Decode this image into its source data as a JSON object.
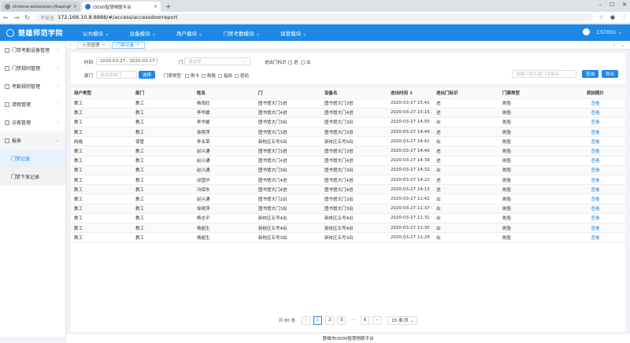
{
  "browser": {
    "tabs": [
      {
        "title": "chrome-extension://kapngfni",
        "active": false
      },
      {
        "title": "I3000智慧物联平台",
        "active": true
      }
    ],
    "new_tab": "+",
    "insecure_label": "不安全",
    "url": "172.168.10.8:8888/#/access/accessdoorreport"
  },
  "app": {
    "title": "楚雄师范学院",
    "nav": [
      "公共模块 ⌄",
      "设备模块 ⌄",
      "用户模块 ⌄",
      "门禁考勤模块 ⌄",
      "保管模块 ⌄"
    ],
    "user": "CST001 ⌄"
  },
  "sidebar": {
    "items": [
      {
        "label": "门禁考勤设备管理"
      },
      {
        "label": "门禁规则管理"
      },
      {
        "label": "考勤规则管理"
      },
      {
        "label": "请假管理"
      },
      {
        "label": "访客管理"
      },
      {
        "label": "报表"
      }
    ],
    "subitems": [
      {
        "label": "门禁记录",
        "active": true
      },
      {
        "label": "门禁下发记录",
        "active": false
      }
    ]
  },
  "page_tabs": [
    {
      "label": "人员管理",
      "active": false
    },
    {
      "label": "门禁记录",
      "active": true
    }
  ],
  "filter": {
    "time_label": "时间",
    "time_value": "2020-03-27 - 2020-03-27",
    "door_label": "门",
    "door_placeholder": "请选择",
    "inout_label": "进出门标识",
    "opt_in": "进",
    "opt_out": "出",
    "dept_label": "部门",
    "dept_placeholder": "请选择部门",
    "select_btn": "选择",
    "type_label": "门禁类型",
    "types": [
      "刷卡",
      "刷脸",
      "指纹",
      "密码"
    ],
    "search_placeholder": "请输入姓名或门设备名",
    "search_btn": "查询",
    "export_btn": "导出"
  },
  "table": {
    "columns": [
      "用户类型",
      "部门",
      "姓名",
      "门",
      "设备名",
      "进出时间 ⇕",
      "进出门标识",
      "门禁类型",
      "抓拍照片"
    ],
    "rows": [
      [
        "教工",
        "教工",
        "杨雨旺",
        "图书馆大门3进",
        "图书馆大门3进",
        "2020-03-27 15:41",
        "进",
        "刷脸",
        "查看"
      ],
      [
        "教工",
        "教工",
        "李华媛",
        "图书馆大门4进",
        "图书馆大门4进",
        "2020-03-27 15:15",
        "进",
        "刷脸",
        "查看"
      ],
      [
        "教工",
        "教工",
        "李华媛",
        "图书馆大门3出",
        "图书馆大门3出",
        "2020-03-27 14:55",
        "出",
        "刷脸",
        "查看"
      ],
      [
        "教工",
        "教工",
        "徐艳萍",
        "图书馆大门3进",
        "图书馆大门3进",
        "2020-03-27 14:44",
        "进",
        "刷脸",
        "查看"
      ],
      [
        "网格",
        "保管",
        "李永荣",
        "新校区五号5出",
        "新校区五号5出",
        "2020-03-27 14:41",
        "出",
        "刷脸",
        "查看"
      ],
      [
        "教工",
        "教工",
        "赵兴通",
        "图书馆大门3进",
        "图书馆大门3进",
        "2020-03-27 14:40",
        "进",
        "刷脸",
        "查看"
      ],
      [
        "教工",
        "教工",
        "赵兴通",
        "图书馆大门4进",
        "图书馆大门4进",
        "2020-03-27 14:39",
        "进",
        "刷脸",
        "查看"
      ],
      [
        "教工",
        "教工",
        "赵兴通",
        "图书馆大门3出",
        "图书馆大门3出",
        "2020-03-27 14:32",
        "出",
        "刷脸",
        "查看"
      ],
      [
        "教工",
        "教工",
        "邱国华",
        "图书馆大门4进",
        "图书馆大门4进",
        "2020-03-27 14:22",
        "进",
        "刷脸",
        "查看"
      ],
      [
        "教工",
        "教工",
        "冯保东",
        "图书馆大门4进",
        "图书馆大门4进",
        "2020-03-27 14:13",
        "进",
        "刷脸",
        "查看"
      ],
      [
        "教工",
        "教工",
        "赵兴通",
        "图书馆大门2出",
        "图书馆大门2出",
        "2020-03-27 11:42",
        "出",
        "刷脸",
        "查看"
      ],
      [
        "教工",
        "教工",
        "徐艳萍",
        "图书馆大门3出",
        "图书馆大门3出",
        "2020-03-27 11:37",
        "出",
        "刷脸",
        "查看"
      ],
      [
        "教工",
        "教工",
        "杨志平",
        "新校区五号4出",
        "新校区五号4出",
        "2020-03-27 11:31",
        "出",
        "刷脸",
        "查看"
      ],
      [
        "教工",
        "教工",
        "杨超生",
        "新校区五号4出",
        "新校区五号4出",
        "2020-03-27 11:30",
        "出",
        "刷脸",
        "查看"
      ],
      [
        "教工",
        "教工",
        "杨超生",
        "新校区五号3出",
        "新校区五号3出",
        "2020-03-27 11:29",
        "出",
        "刷脸",
        "查看"
      ]
    ]
  },
  "pagination": {
    "total": "共 80 条",
    "prev": "‹",
    "pages": [
      "1",
      "2",
      "3",
      "···",
      "6"
    ],
    "next": "›",
    "page_size": "15 条/页 ⌄"
  },
  "footer": "楚雄市I3000智慧物联平台"
}
